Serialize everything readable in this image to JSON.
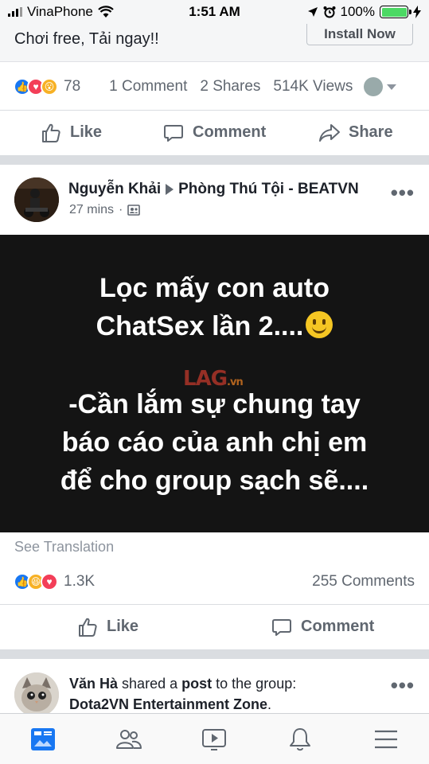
{
  "status_bar": {
    "carrier": "VinaPhone",
    "time": "1:51 AM",
    "battery": "100%"
  },
  "ad_post": {
    "ad_text": "Chơi free, Tải ngay!!",
    "install_label": "Install Now",
    "reaction_count": "78",
    "comments": "1 Comment",
    "shares": "2 Shares",
    "views": "514K Views"
  },
  "actions": {
    "like": "Like",
    "comment": "Comment",
    "share": "Share"
  },
  "post": {
    "author": "Nguyễn Khải",
    "group": "Phòng Thú Tội - BEATVN",
    "time": "27 mins",
    "image_lines": [
      "Lọc mấy con auto",
      "ChatSex lần 2....",
      "-Cần lắm sự chung tay",
      "báo cáo của anh chị em",
      "để cho group sạch sẽ...."
    ],
    "watermark": "LAG",
    "watermark_suffix": ".vn",
    "see_translation": "See Translation",
    "reaction_count": "1.3K",
    "comments": "255 Comments"
  },
  "shared_post": {
    "author": "Văn Hà",
    "text1": "shared a",
    "link": "post",
    "text2": "to the group:",
    "group": "Dota2VN Entertainment Zone",
    "period": "."
  },
  "colors": {
    "accent": "#1877f2",
    "love": "#f33e58",
    "muted": "#606770"
  }
}
